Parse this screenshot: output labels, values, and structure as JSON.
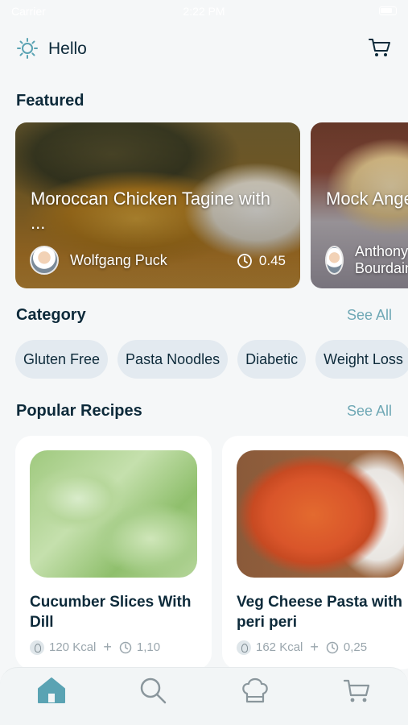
{
  "status_bar": {
    "carrier": "Carrier",
    "time": "2:22 PM"
  },
  "header": {
    "greeting": "Hello",
    "icon": "sun-icon",
    "cart_icon": "cart-icon"
  },
  "featured": {
    "title": "Featured",
    "cards": [
      {
        "title": "Moroccan Chicken Tagine with ...",
        "author": "Wolfgang Puck",
        "time": "0.45"
      },
      {
        "title": "Mock Angel Food Cake",
        "author": "Anthony Bourdain",
        "time": ""
      }
    ]
  },
  "category": {
    "title": "Category",
    "see_all": "See All",
    "chips": [
      "Gluten Free",
      "Pasta Noodles",
      "Diabetic",
      "Weight Loss"
    ]
  },
  "popular": {
    "title": "Popular Recipes",
    "see_all": "See All",
    "recipes": [
      {
        "title": "Cucumber Slices With Dill",
        "kcal": "120 Kcal",
        "time": "1,10"
      },
      {
        "title": "Veg Cheese Pasta with peri peri",
        "kcal": "162 Kcal",
        "time": "0,25"
      }
    ]
  },
  "bottom_nav": {
    "items": [
      "home-icon",
      "search-icon",
      "chef-hat-icon",
      "cart-icon"
    ],
    "active": "home-icon",
    "active_color": "#5aa3b3",
    "inactive_color": "#8a969c"
  },
  "colors": {
    "accent": "#6fa8b5",
    "text": "#0d2a3a",
    "chip_bg": "#e3eaf0",
    "background": "#f5f7f8"
  }
}
